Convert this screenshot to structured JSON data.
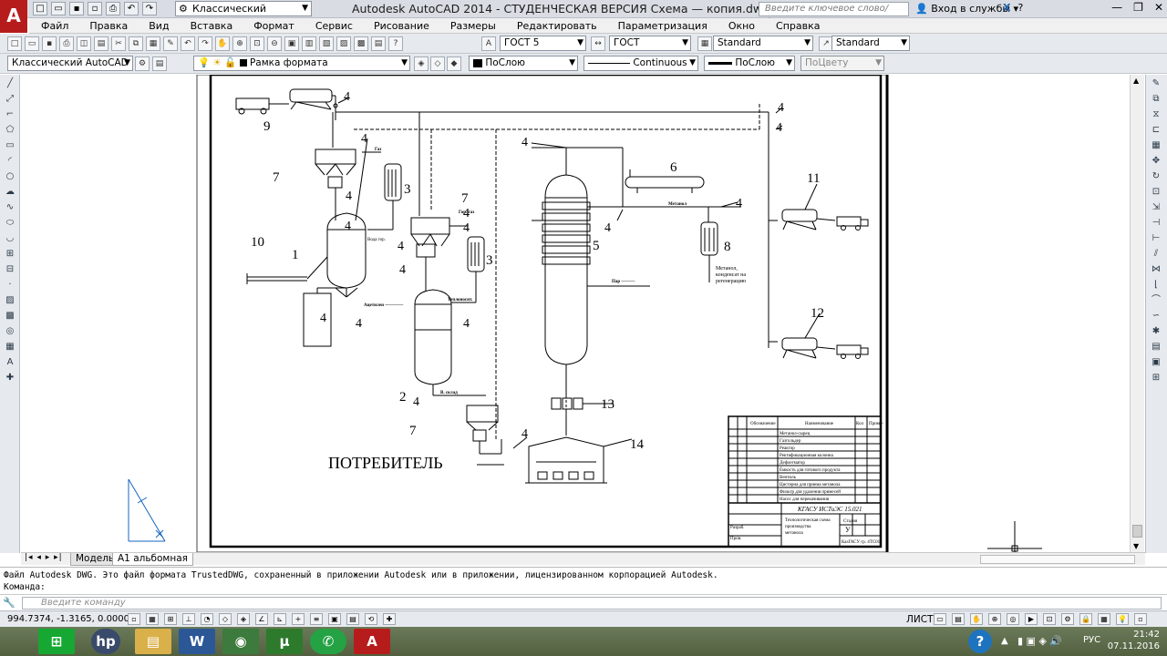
{
  "app": {
    "logo": "A",
    "window_title": "Autodesk AutoCAD 2014 - СТУДЕНЧЕСКАЯ ВЕРСИЯ   Схема — копия.dwg"
  },
  "workspace": {
    "value": "Классический AutoCAD"
  },
  "search": {
    "placeholder": "Введите ключевое слово/фразу"
  },
  "signin": {
    "label": "Вход в службы"
  },
  "menu": [
    "Файл",
    "Правка",
    "Вид",
    "Вставка",
    "Формат",
    "Сервис",
    "Рисование",
    "Размеры",
    "Редактировать",
    "Параметризация",
    "Окно",
    "Справка"
  ],
  "toolbar1": {
    "text_style": "ГОСТ 5",
    "dim_style": "ГОСТ",
    "table_style": "Standard",
    "mleader_style": "Standard"
  },
  "toolbar2": {
    "workspace": "Классический AutoCAD",
    "layer": "Рамка формата",
    "color": "ПоСлою",
    "linetype": "Continuous",
    "lineweight": "ПоСлою",
    "plotstyle": "ПоЦвету"
  },
  "tabs": {
    "model": "Модель",
    "layout": "А1 альбомная"
  },
  "drawing": {
    "labels": {
      "n1": "1",
      "n2": "2",
      "n3a": "3",
      "n3b": "3",
      "n4": "4",
      "n5": "5",
      "n6": "6",
      "n7a": "7",
      "n7b": "7",
      "n7c": "7",
      "n8": "8",
      "n9": "9",
      "n10": "10",
      "n11": "11",
      "n12": "12",
      "n13": "13",
      "n14": "14"
    },
    "consumer": "ПОТРЕБИТЕЛЬ",
    "notes": {
      "methanol": "Метанол, конденсат на регенерацию",
      "voda": "Вода гор."
    },
    "title_block": {
      "code": "КГАСУ ИСТиЭС 15.021",
      "stage": "У"
    }
  },
  "command": {
    "history_line1": "Файл Autodesk DWG. Это файл формата TrustedDWG, сохраненный в приложении Autodesk или в приложении, лицензированном корпорацией Autodesk.",
    "history_line2": "Команда:",
    "placeholder": "Введите команду"
  },
  "status": {
    "coords": "994.7374, -1.3165, 0.0000",
    "sheet": "ЛИСТ"
  },
  "taskbar": {
    "lang": "РУС",
    "time": "21:42",
    "date": "07.11.2016"
  }
}
